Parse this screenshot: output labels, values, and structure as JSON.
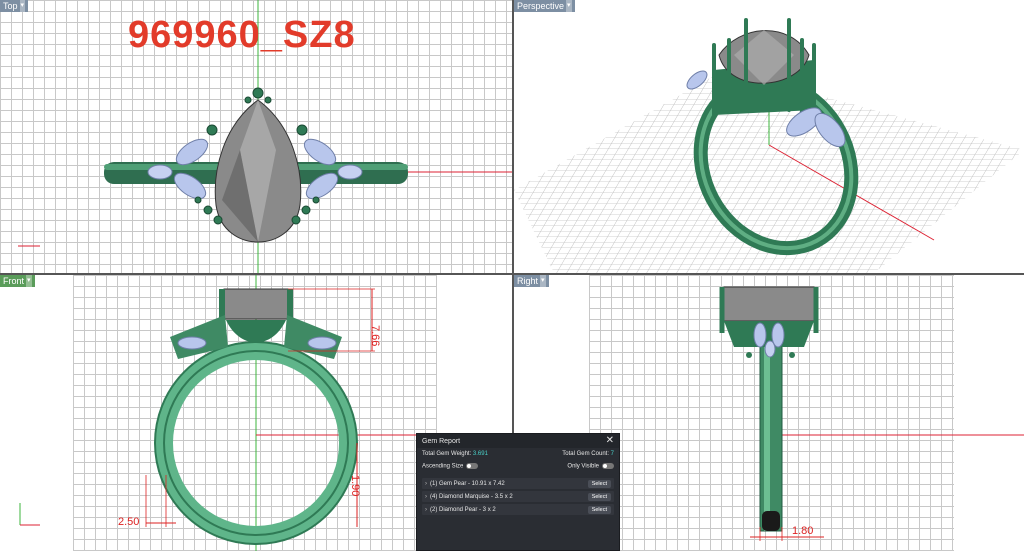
{
  "viewports": {
    "top": {
      "label": "Top"
    },
    "perspective": {
      "label": "Perspective"
    },
    "front": {
      "label": "Front"
    },
    "right": {
      "label": "Right"
    }
  },
  "model_title": "969960_SZ8",
  "dimensions": {
    "front_height": "7.66",
    "front_band": "1.90",
    "front_shank": "2.50",
    "right_shank": "1.80"
  },
  "colors": {
    "metal": "#3f8a64",
    "metal_dark": "#1f5a40",
    "stone": "#7a7a7a",
    "diamond": "#b8c6ec",
    "dimension": "#dd2222"
  },
  "gem_report": {
    "title": "Gem Report",
    "total_weight_label": "Total Gem Weight:",
    "total_weight_value": "3.691",
    "total_count_label": "Total Gem Count:",
    "total_count_value": "7",
    "ascending_label": "Ascending Size",
    "only_visible_label": "Only Visible",
    "gems": [
      {
        "label": "(1) Gem Pear - 10.91 x 7.42",
        "button": "Select"
      },
      {
        "label": "(4) Diamond Marquise - 3.5 x 2",
        "button": "Select"
      },
      {
        "label": "(2) Diamond Pear - 3 x 2",
        "button": "Select"
      }
    ]
  }
}
